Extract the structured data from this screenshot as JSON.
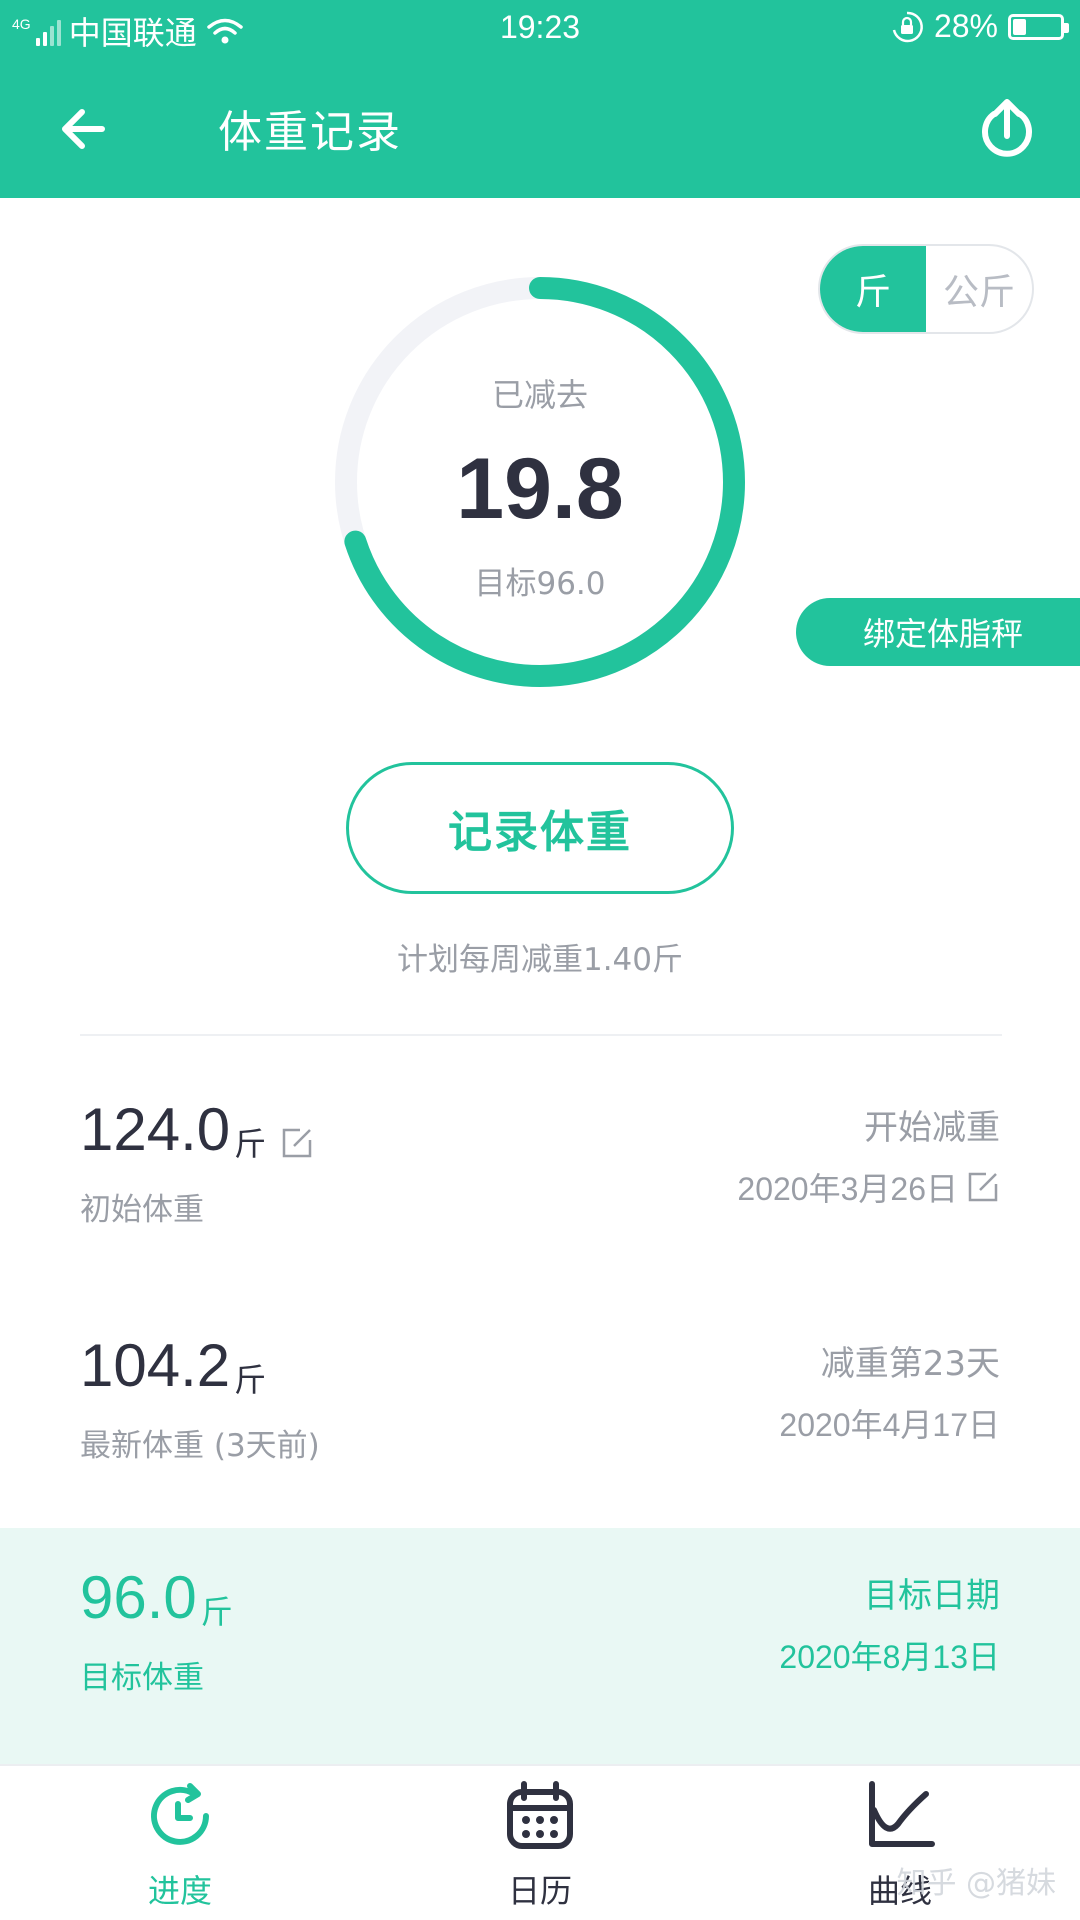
{
  "status_bar": {
    "network_type": "4G",
    "carrier": "中国联通",
    "time": "19:23",
    "battery_percent": "28%",
    "battery_level": 0.28
  },
  "header": {
    "title": "体重记录",
    "back_icon": "arrow-left-icon",
    "share_icon": "upload-share-icon"
  },
  "unit_toggle": {
    "options": [
      "斤",
      "公斤"
    ],
    "selected": "斤"
  },
  "progress": {
    "label": "已减去",
    "value": "19.8",
    "target_text": "目标96.0",
    "fraction": 0.7
  },
  "bind_scale_label": "绑定体脂秤",
  "record_button_label": "记录体重",
  "plan_text": "计划每周减重1.40斤",
  "rows": [
    {
      "value": "124.0",
      "unit": "斤",
      "label": "初始体重",
      "right_title": "开始减重",
      "right_date": "2020年3月26日",
      "editable": true
    },
    {
      "value": "104.2",
      "unit": "斤",
      "label": "最新体重 (3天前)",
      "right_title": "减重第23天",
      "right_date": "2020年4月17日",
      "editable": false
    },
    {
      "value": "96.0",
      "unit": "斤",
      "label": "目标体重",
      "right_title": "目标日期",
      "right_date": "2020年8月13日",
      "editable": false
    }
  ],
  "tabs": [
    {
      "label": "进度",
      "icon": "clock-refresh-icon",
      "active": true
    },
    {
      "label": "日历",
      "icon": "calendar-icon",
      "active": false
    },
    {
      "label": "曲线",
      "icon": "line-chart-icon",
      "active": false
    }
  ],
  "watermark": "知乎 @猪妹",
  "colors": {
    "accent": "#22c39c",
    "text_dark": "#2f3140",
    "text_muted": "#9a9ea6",
    "highlight_bg": "#e9f8f4",
    "ring_track": "#f2f3f7"
  }
}
